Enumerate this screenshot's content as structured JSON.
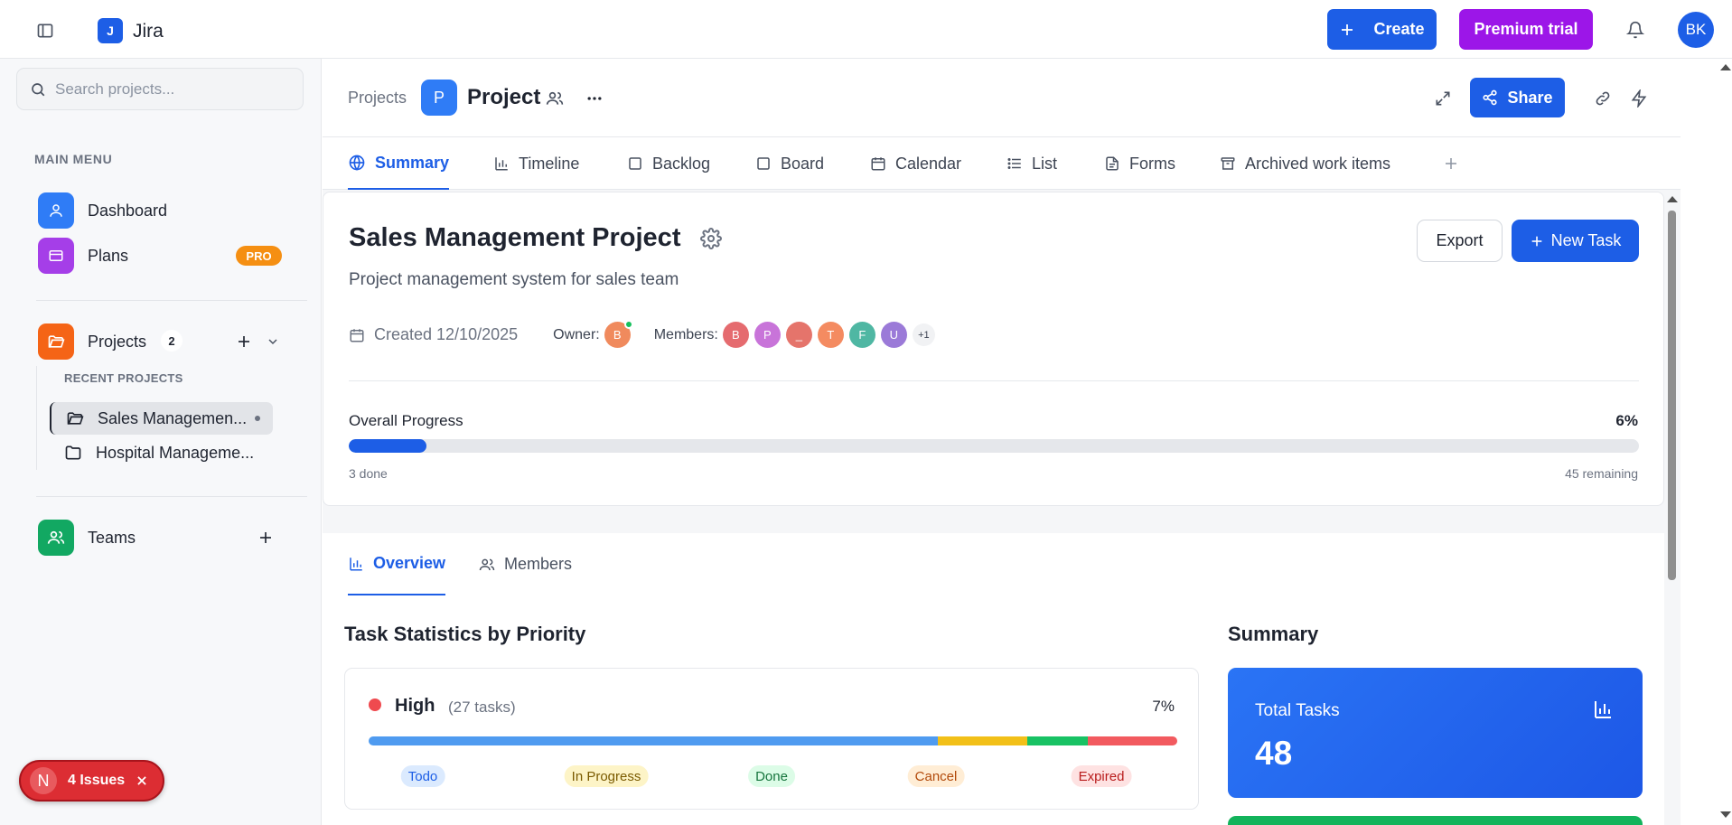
{
  "topbar": {
    "app_logo_letter": "J",
    "app_name": "Jira",
    "create_label": "Create",
    "premium_label": "Premium trial",
    "user_initials": "BK"
  },
  "sidebar": {
    "search_placeholder": "Search projects...",
    "menu_title": "MAIN MENU",
    "items": [
      {
        "label": "Dashboard",
        "icon": "user-icon",
        "color": "#2f7cf6"
      },
      {
        "label": "Plans",
        "icon": "credit-card-icon",
        "color": "#a53ee8",
        "badge": "PRO"
      }
    ],
    "projects": {
      "label": "Projects",
      "count": "2",
      "icon": "folder-open-icon",
      "color": "#f56416"
    },
    "recent_title": "RECENT PROJECTS",
    "recent": [
      {
        "label": "Sales Managemen..."
      },
      {
        "label": "Hospital Manageme..."
      }
    ],
    "teams": {
      "label": "Teams",
      "icon": "users-icon",
      "color": "#12a862"
    }
  },
  "issues_toast": {
    "avatar_letter": "N",
    "label": "4 Issues"
  },
  "header": {
    "breadcrumb": "Projects",
    "project_letter": "P",
    "project_title": "Project",
    "share_label": "Share"
  },
  "tabs": [
    {
      "label": "Summary",
      "icon": "globe-icon",
      "active": true
    },
    {
      "label": "Timeline",
      "icon": "bar-chart-icon"
    },
    {
      "label": "Backlog",
      "icon": "square-icon"
    },
    {
      "label": "Board",
      "icon": "square-icon"
    },
    {
      "label": "Calendar",
      "icon": "calendar-icon"
    },
    {
      "label": "List",
      "icon": "list-icon"
    },
    {
      "label": "Forms",
      "icon": "file-text-icon"
    },
    {
      "label": "Archived work items",
      "icon": "archive-icon"
    }
  ],
  "project": {
    "title": "Sales Management Project",
    "description": "Project management system for sales team",
    "export_label": "Export",
    "new_task_label": "New Task",
    "created": "Created 12/10/2025",
    "owner_label": "Owner:",
    "owner_initial": "B",
    "owner_color": "#f08a5d",
    "members_label": "Members:",
    "members": [
      {
        "initial": "B",
        "color": "#e56b6f"
      },
      {
        "initial": "P",
        "color": "#c874d9"
      },
      {
        "initial": "_",
        "color": "#e5746b"
      },
      {
        "initial": "T",
        "color": "#f48b61"
      },
      {
        "initial": "F",
        "color": "#4fb7a3"
      },
      {
        "initial": "U",
        "color": "#9b7ad8"
      }
    ],
    "members_more": "+1"
  },
  "progress": {
    "label": "Overall Progress",
    "percent_text": "6%",
    "fraction": 0.06,
    "done_text": "3 done",
    "remaining_text": "45 remaining"
  },
  "subtabs": [
    {
      "label": "Overview",
      "active": true
    },
    {
      "label": "Members"
    }
  ],
  "stats": {
    "title": "Task Statistics by Priority",
    "priority": {
      "name": "High",
      "count_text": "(27 tasks)",
      "percent_text": "7%",
      "segments": [
        {
          "label": "Todo",
          "fraction": 0.704,
          "color": "#4f9bf0",
          "bg": "#dbeafe",
          "fg": "#1d5ee6"
        },
        {
          "label": "In Progress",
          "fraction": 0.111,
          "color": "#f2c018",
          "bg": "#fdf4c7",
          "fg": "#7a5a00"
        },
        {
          "label": "Done",
          "fraction": 0.074,
          "color": "#18c264",
          "bg": "#dcfce7",
          "fg": "#16753d"
        },
        {
          "label": "Cancel",
          "fraction": 0.0,
          "color": "#f59b4c",
          "bg": "#ffedd5",
          "fg": "#b24a0b"
        },
        {
          "label": "Expired",
          "fraction": 0.111,
          "color": "#f25a5f",
          "bg": "#fee2e2",
          "fg": "#b91c1c"
        }
      ]
    }
  },
  "summary": {
    "title": "Summary",
    "total_label": "Total Tasks",
    "total_value": "48"
  }
}
